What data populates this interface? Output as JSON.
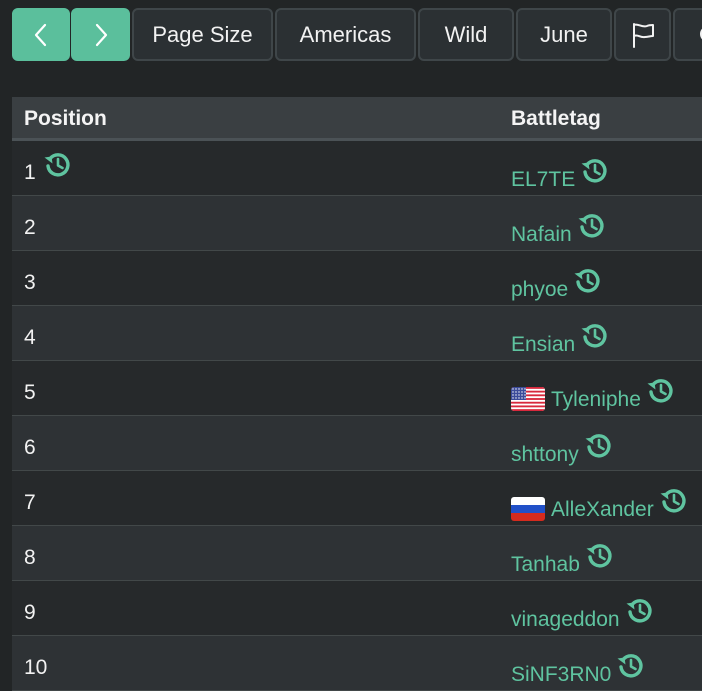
{
  "toolbar": {
    "prev_icon": "chevron-left-icon",
    "next_icon": "chevron-right-icon",
    "page_size_label": "Page Size",
    "region_label": "Americas",
    "mode_label": "Wild",
    "month_label": "June",
    "flag_icon": "flag-icon",
    "accent_color": "#5bbf9c"
  },
  "table": {
    "headers": {
      "position": "Position",
      "battletag": "Battletag"
    },
    "history_icon": "history-icon",
    "rows": [
      {
        "position": "1",
        "battletag": "EL7TE",
        "flag": ""
      },
      {
        "position": "2",
        "battletag": "Nafain",
        "flag": ""
      },
      {
        "position": "3",
        "battletag": "phyoe",
        "flag": ""
      },
      {
        "position": "4",
        "battletag": "Ensian",
        "flag": ""
      },
      {
        "position": "5",
        "battletag": "Tyleniphe",
        "flag": "us-flag-icon"
      },
      {
        "position": "6",
        "battletag": "shttony",
        "flag": ""
      },
      {
        "position": "7",
        "battletag": "AlleXander",
        "flag": "ru-flag-icon"
      },
      {
        "position": "8",
        "battletag": "Tanhab",
        "flag": ""
      },
      {
        "position": "9",
        "battletag": "vinageddon",
        "flag": ""
      },
      {
        "position": "10",
        "battletag": "SiNF3RN0",
        "flag": ""
      }
    ]
  }
}
